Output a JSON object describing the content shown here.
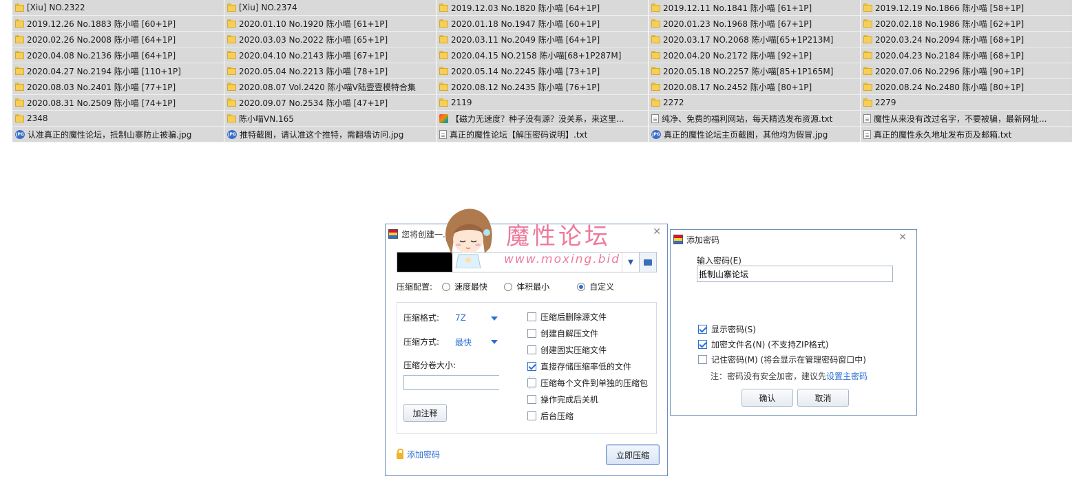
{
  "files": [
    {
      "name": "[Xiu] NO.2322",
      "icon": "folder"
    },
    {
      "name": "[Xiu] NO.2374",
      "icon": "folder"
    },
    {
      "name": "2019.12.03 No.1820 陈小喵 [64+1P]",
      "icon": "folder"
    },
    {
      "name": "2019.12.11 No.1841 陈小喵 [61+1P]",
      "icon": "folder"
    },
    {
      "name": "2019.12.19 No.1866 陈小喵 [58+1P]",
      "icon": "folder"
    },
    {
      "name": "2019.12.26 No.1883 陈小喵 [60+1P]",
      "icon": "folder"
    },
    {
      "name": "2020.01.10 No.1920 陈小喵 [61+1P]",
      "icon": "folder"
    },
    {
      "name": "2020.01.18 No.1947 陈小喵 [60+1P]",
      "icon": "folder"
    },
    {
      "name": "2020.01.23 No.1968 陈小喵 [67+1P]",
      "icon": "folder"
    },
    {
      "name": "2020.02.18 No.1986 陈小喵 [62+1P]",
      "icon": "folder"
    },
    {
      "name": "2020.02.26 No.2008 陈小喵 [64+1P]",
      "icon": "folder"
    },
    {
      "name": "2020.03.03 No.2022 陈小喵 [65+1P]",
      "icon": "folder"
    },
    {
      "name": "2020.03.11 No.2049 陈小喵 [64+1P]",
      "icon": "folder"
    },
    {
      "name": "2020.03.17 NO.2068 陈小喵[65+1P213M]",
      "icon": "folder"
    },
    {
      "name": "2020.03.24 No.2094 陈小喵 [68+1P]",
      "icon": "folder"
    },
    {
      "name": "2020.04.08 No.2136 陈小喵 [64+1P]",
      "icon": "folder"
    },
    {
      "name": "2020.04.10 No.2143 陈小喵 [67+1P]",
      "icon": "folder"
    },
    {
      "name": "2020.04.15 NO.2158 陈小喵[68+1P287M]",
      "icon": "folder"
    },
    {
      "name": "2020.04.20 No.2172 陈小喵 [92+1P]",
      "icon": "folder"
    },
    {
      "name": "2020.04.23 No.2184 陈小喵 [68+1P]",
      "icon": "folder"
    },
    {
      "name": "2020.04.27 No.2194 陈小喵 [110+1P]",
      "icon": "folder"
    },
    {
      "name": "2020.05.04 No.2213 陈小喵 [78+1P]",
      "icon": "folder"
    },
    {
      "name": "2020.05.14 No.2245 陈小喵 [73+1P]",
      "icon": "folder"
    },
    {
      "name": "2020.05.18 NO.2257 陈小喵[85+1P165M]",
      "icon": "folder"
    },
    {
      "name": "2020.07.06 No.2296 陈小喵 [90+1P]",
      "icon": "folder"
    },
    {
      "name": "2020.08.03 No.2401 陈小喵 [77+1P]",
      "icon": "folder"
    },
    {
      "name": "2020.08.07 Vol.2420 陈小喵V陆壹壹模特合集",
      "icon": "folder"
    },
    {
      "name": "2020.08.12 No.2435 陈小喵 [76+1P]",
      "icon": "folder"
    },
    {
      "name": "2020.08.17 No.2452 陈小喵 [80+1P]",
      "icon": "folder"
    },
    {
      "name": "2020.08.24 No.2480 陈小喵 [80+1P]",
      "icon": "folder"
    },
    {
      "name": "2020.08.31 No.2509 陈小喵 [74+1P]",
      "icon": "folder"
    },
    {
      "name": "2020.09.07 No.2534 陈小喵 [47+1P]",
      "icon": "folder"
    },
    {
      "name": "2119",
      "icon": "folder"
    },
    {
      "name": "2272",
      "icon": "folder"
    },
    {
      "name": "2279",
      "icon": "folder"
    },
    {
      "name": "2348",
      "icon": "folder"
    },
    {
      "name": "陈小喵VN.165",
      "icon": "folder"
    },
    {
      "name": "【磁力无速度？种子没有源？没关系，来这里...",
      "icon": "url"
    },
    {
      "name": "纯净、免费的福利网站，每天精选发布资源.txt",
      "icon": "txt"
    },
    {
      "name": "魔性从来没有改过名字，不要被骗，最新网址...",
      "icon": "txt"
    },
    {
      "name": "认准真正的魔性论坛，抵制山寨防止被骗.jpg",
      "icon": "jpg"
    },
    {
      "name": "推特截图，请认准这个推特，需翻墙访问.jpg",
      "icon": "jpg"
    },
    {
      "name": "真正的魔性论坛【解压密码说明】.txt",
      "icon": "txt"
    },
    {
      "name": "真正的魔性论坛主页截图，其他均为假冒.jpg",
      "icon": "jpg"
    },
    {
      "name": "真正的魔性永久地址发布页及邮箱.txt",
      "icon": "txt"
    }
  ],
  "icons": {
    "jpg_badge": "JPG"
  },
  "compress_dialog": {
    "title": "您将创建一...360压缩",
    "path_value": "",
    "overlay_text": "魔性论坛",
    "config_label": "压缩配置:",
    "config_options": [
      "速度最快",
      "体积最小",
      "自定义"
    ],
    "config_selected": "自定义",
    "format_label": "压缩格式:",
    "format_value": "7Z",
    "method_label": "压缩方式:",
    "method_value": "最快",
    "split_label": "压缩分卷大小:",
    "split_value": "",
    "comment_button": "加注释",
    "checkboxes": [
      {
        "label": "压缩后删除源文件",
        "checked": false
      },
      {
        "label": "创建自解压文件",
        "checked": false
      },
      {
        "label": "创建固实压缩文件",
        "checked": false
      },
      {
        "label": "直接存储压缩率低的文件",
        "checked": true
      },
      {
        "label": "压缩每个文件到单独的压缩包",
        "checked": false
      },
      {
        "label": "操作完成后关机",
        "checked": false
      },
      {
        "label": "后台压缩",
        "checked": false
      }
    ],
    "add_password_link": "添加密码",
    "compress_button": "立即压缩"
  },
  "password_dialog": {
    "title": "添加密码",
    "input_label": "输入密码(E)",
    "password_value": "抵制山寨论坛",
    "checkboxes": [
      {
        "label": "显示密码(S)",
        "checked": true
      },
      {
        "label": "加密文件名(N) (不支持ZIP格式)",
        "checked": true
      },
      {
        "label": "记住密码(M) (将会显示在管理密码窗口中)",
        "checked": false
      }
    ],
    "note_prefix": "注：密码没有安全加密，建议先",
    "note_link": "设置主密码",
    "ok_button": "确认",
    "cancel_button": "取消"
  },
  "watermark": {
    "title": "魔性论坛",
    "url": "www.moxing.bid"
  },
  "colors": {
    "accent": "#2b6fd1",
    "watermark": "#ec6d92",
    "grid_bg": "#d9d9d9"
  }
}
